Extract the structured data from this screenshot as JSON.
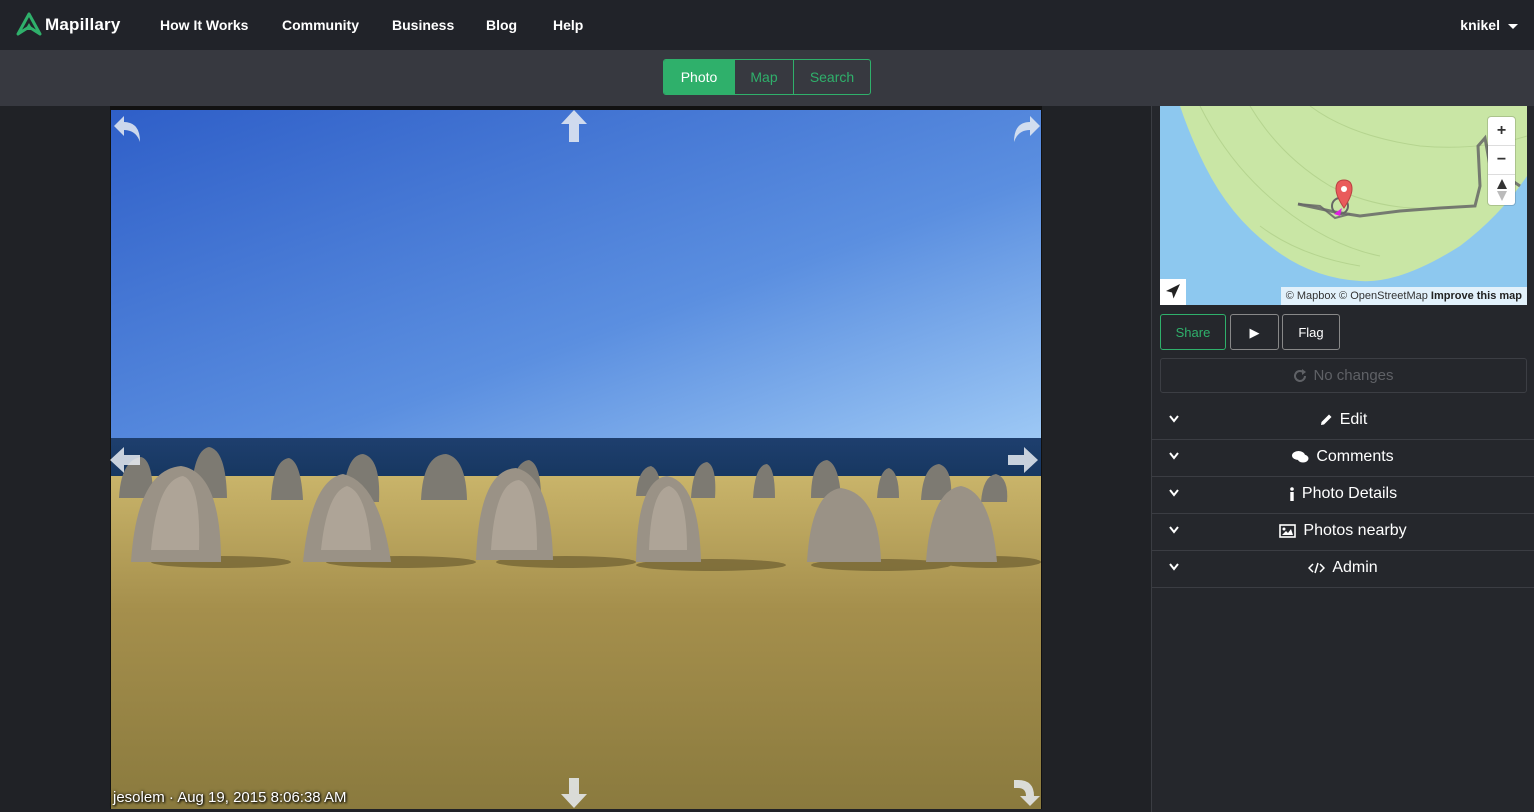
{
  "app": {
    "name": "Mapillary"
  },
  "nav": {
    "items": [
      "How It Works",
      "Community",
      "Business",
      "Blog",
      "Help"
    ],
    "user": "knikel"
  },
  "view_tabs": [
    {
      "label": "Photo",
      "active": true
    },
    {
      "label": "Map",
      "active": false
    },
    {
      "label": "Search",
      "active": false
    }
  ],
  "photo": {
    "credit": "jesolem · Aug 19, 2015 8:06:38 AM"
  },
  "minimap": {
    "zoom_in": "+",
    "zoom_out": "−",
    "attribution": "© Mapbox © OpenStreetMap",
    "improve": "Improve this map"
  },
  "actions": {
    "share": "Share",
    "play": "▶",
    "flag": "Flag",
    "status": "No changes"
  },
  "sections": [
    {
      "label": "Edit",
      "icon": "pencil-icon"
    },
    {
      "label": "Comments",
      "icon": "comments-icon"
    },
    {
      "label": "Photo Details",
      "icon": "info-icon"
    },
    {
      "label": "Photos nearby",
      "icon": "image-icon"
    },
    {
      "label": "Admin",
      "icon": "code-icon"
    }
  ],
  "colors": {
    "accent": "#2fb06b",
    "background": "#202226",
    "bar": "#373940"
  }
}
